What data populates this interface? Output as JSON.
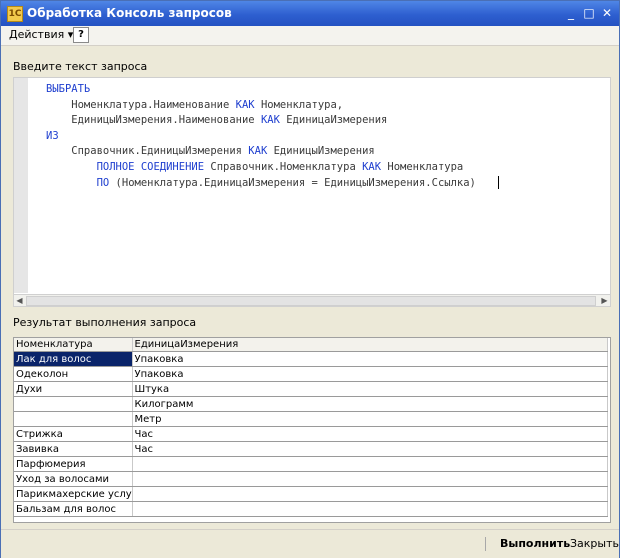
{
  "window": {
    "title": "Обработка  Консоль запросов",
    "icon": "1C",
    "controls": [
      "_",
      "□",
      "✕"
    ]
  },
  "toolbar": {
    "actions_label": "Действия ▾",
    "help_label": "?"
  },
  "query": {
    "label": "Введите текст запроса",
    "lines": [
      [
        {
          "t": "ВЫБРАТЬ",
          "k": true
        }
      ],
      [
        {
          "t": "    Номенклатура.Наименование "
        },
        {
          "t": "КАК",
          "k": true
        },
        {
          "t": " Номенклатура,"
        }
      ],
      [
        {
          "t": "    ЕдиницыИзмерения.Наименование "
        },
        {
          "t": "КАК",
          "k": true
        },
        {
          "t": " ЕдиницаИзмерения"
        }
      ],
      [
        {
          "t": "ИЗ",
          "k": true
        }
      ],
      [
        {
          "t": "    Справочник.ЕдиницыИзмерения "
        },
        {
          "t": "КАК",
          "k": true
        },
        {
          "t": " ЕдиницыИзмерения"
        }
      ],
      [
        {
          "t": "        "
        },
        {
          "t": "ПОЛНОЕ СОЕДИНЕНИЕ",
          "k": true
        },
        {
          "t": " Справочник.Номенклатура "
        },
        {
          "t": "КАК",
          "k": true
        },
        {
          "t": " Номенклатура"
        }
      ],
      [
        {
          "t": "        "
        },
        {
          "t": "ПО",
          "k": true
        },
        {
          "t": " (Номенклатура.ЕдиницаИзмерения = ЕдиницыИзмерения.Ссылка)"
        },
        {
          "caret": true
        }
      ]
    ]
  },
  "result": {
    "label": "Результат выполнения запроса",
    "columns": [
      "Номенклатура",
      "ЕдиницаИзмерения"
    ],
    "rows": [
      [
        "Лак для волос",
        "Упаковка"
      ],
      [
        "Одеколон",
        "Упаковка"
      ],
      [
        "Духи",
        "Штука"
      ],
      [
        "",
        "Килограмм"
      ],
      [
        "",
        "Метр"
      ],
      [
        "Стрижка",
        "Час"
      ],
      [
        "Завивка",
        "Час"
      ],
      [
        "Парфюмерия",
        ""
      ],
      [
        "Уход за волосами",
        ""
      ],
      [
        "Парикмахерские услуги",
        ""
      ],
      [
        "Бальзам для волос",
        ""
      ]
    ],
    "selected_row": 0
  },
  "footer": {
    "run_label": "Выполнить",
    "close_label": "Закрыть"
  },
  "colors": {
    "title_bar": "#2e5fd0",
    "keyword": "#1f3fcf",
    "selection": "#0a246a"
  }
}
